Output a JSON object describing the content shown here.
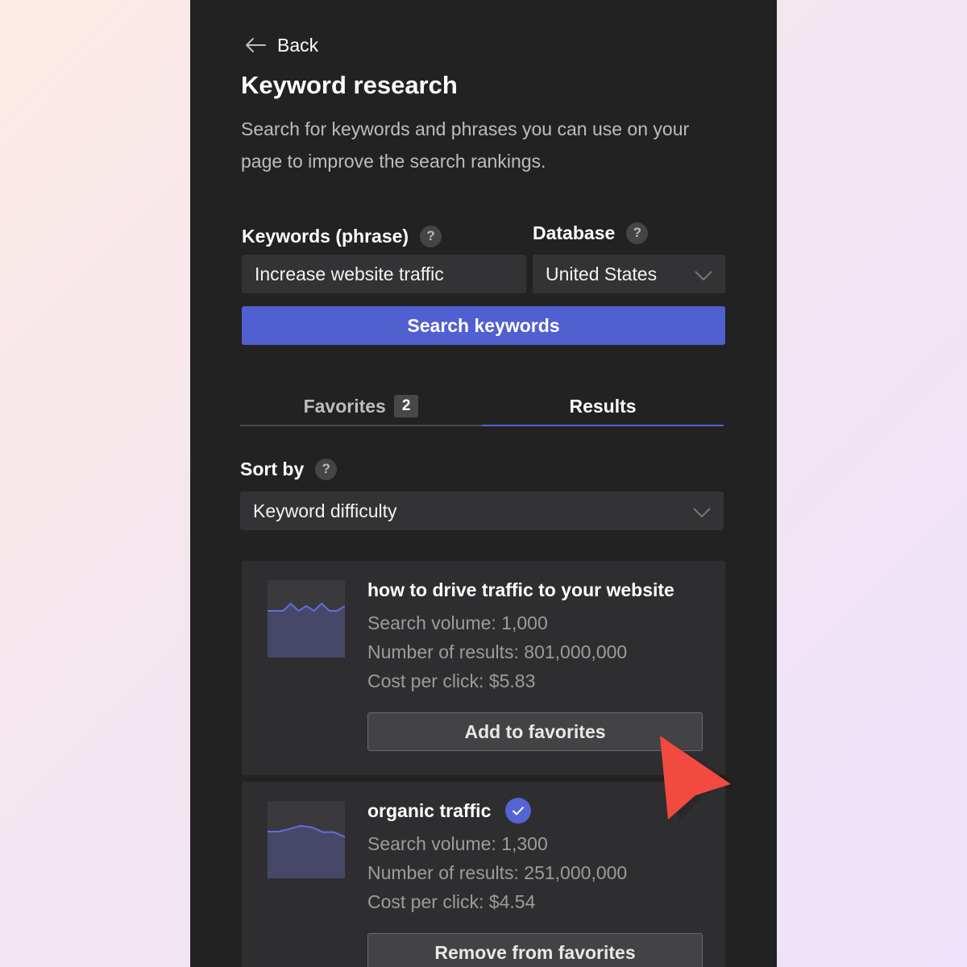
{
  "nav": {
    "back_label": "Back",
    "back_icon": "arrow-left-icon"
  },
  "page": {
    "title": "Keyword research",
    "description": "Search for keywords and phrases you can use on your page to improve the search rankings."
  },
  "form": {
    "keywords_label": "Keywords (phrase)",
    "keywords_value": "Increase website traffic",
    "database_label": "Database",
    "database_value": "United States",
    "help_symbol": "?",
    "search_button": "Search keywords"
  },
  "tabs": [
    {
      "label": "Favorites",
      "badge": "2",
      "active": false
    },
    {
      "label": "Results",
      "active": true
    }
  ],
  "sort": {
    "label": "Sort by",
    "value": "Keyword difficulty"
  },
  "results": [
    {
      "keyword": "how to drive traffic to your website",
      "search_volume": "Search volume: 1,000",
      "num_results": "Number of results: 801,000,000",
      "cpc": "Cost per click: $5.83",
      "button": "Add to favorites",
      "favorited": false,
      "trend": [
        4,
        4,
        4,
        1,
        4,
        2,
        4,
        1,
        4,
        4,
        2
      ]
    },
    {
      "keyword": "organic traffic",
      "search_volume": "Search volume: 1,300",
      "num_results": "Number of results: 251,000,000",
      "cpc": "Cost per click: $4.54",
      "button": "Remove from favorites",
      "favorited": true,
      "trend": [
        3.6,
        3.6,
        2.5,
        1.2,
        1.8,
        3.8,
        3.8,
        5.8
      ]
    }
  ],
  "colors": {
    "panel_bg": "#222222",
    "accent": "#5060d0",
    "card_bg": "#2e2e30",
    "cursor": "#f24a40"
  }
}
